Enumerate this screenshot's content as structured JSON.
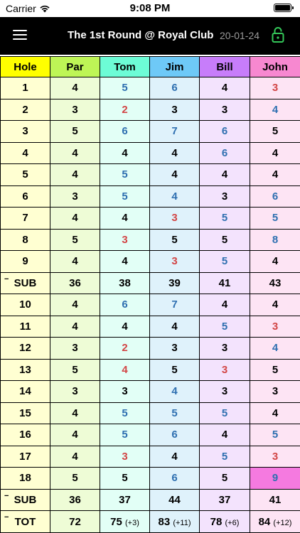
{
  "status_bar": {
    "carrier": "Carrier",
    "time": "9:08 PM"
  },
  "nav": {
    "title": "The 1st Round @ Royal Club",
    "date": "20-01-24"
  },
  "headers": [
    "Hole",
    "Par",
    "Tom",
    "Jim",
    "Bill",
    "John"
  ],
  "header_colors": [
    "#ffff00",
    "#bef556",
    "#6dfcd6",
    "#6ec9f7",
    "#c77dfa",
    "#f788d0"
  ],
  "column_tints": [
    "#ffffd2",
    "#eefcd6",
    "#e2fff6",
    "#dff2fb",
    "#f3e3fd",
    "#fde4f4"
  ],
  "hole_rows": [
    {
      "hole": "1",
      "par": "4",
      "scores": [
        "5",
        "6",
        "4",
        "3"
      ]
    },
    {
      "hole": "2",
      "par": "3",
      "scores": [
        "2",
        "3",
        "3",
        "4"
      ]
    },
    {
      "hole": "3",
      "par": "5",
      "scores": [
        "6",
        "7",
        "6",
        "5"
      ]
    },
    {
      "hole": "4",
      "par": "4",
      "scores": [
        "4",
        "4",
        "6",
        "4"
      ]
    },
    {
      "hole": "5",
      "par": "4",
      "scores": [
        "5",
        "4",
        "4",
        "4"
      ]
    },
    {
      "hole": "6",
      "par": "3",
      "scores": [
        "5",
        "4",
        "3",
        "6"
      ]
    },
    {
      "hole": "7",
      "par": "4",
      "scores": [
        "4",
        "3",
        "5",
        "5"
      ]
    },
    {
      "hole": "8",
      "par": "5",
      "scores": [
        "3",
        "5",
        "5",
        "8"
      ]
    },
    {
      "hole": "9",
      "par": "4",
      "scores": [
        "4",
        "3",
        "5",
        "4"
      ]
    },
    {
      "hole": "SUB",
      "par": "36",
      "scores": [
        "38",
        "39",
        "41",
        "43"
      ],
      "type": "sub"
    },
    {
      "hole": "10",
      "par": "4",
      "scores": [
        "6",
        "7",
        "4",
        "4"
      ]
    },
    {
      "hole": "11",
      "par": "4",
      "scores": [
        "4",
        "4",
        "5",
        "3"
      ]
    },
    {
      "hole": "12",
      "par": "3",
      "scores": [
        "2",
        "3",
        "3",
        "4"
      ]
    },
    {
      "hole": "13",
      "par": "5",
      "scores": [
        "4",
        "5",
        "3",
        "5"
      ]
    },
    {
      "hole": "14",
      "par": "3",
      "scores": [
        "3",
        "4",
        "3",
        "3"
      ]
    },
    {
      "hole": "15",
      "par": "4",
      "scores": [
        "5",
        "5",
        "5",
        "4"
      ]
    },
    {
      "hole": "16",
      "par": "4",
      "scores": [
        "5",
        "6",
        "4",
        "5"
      ]
    },
    {
      "hole": "17",
      "par": "4",
      "scores": [
        "3",
        "4",
        "5",
        "3"
      ]
    },
    {
      "hole": "18",
      "par": "5",
      "scores": [
        "5",
        "6",
        "5",
        "9"
      ]
    },
    {
      "hole": "SUB",
      "par": "36",
      "scores": [
        "37",
        "44",
        "37",
        "41"
      ],
      "type": "sub"
    }
  ],
  "total_row": {
    "label": "TOT",
    "par": "72",
    "scores": [
      "75",
      "83",
      "78",
      "84"
    ],
    "diffs": [
      "(+3)",
      "(+11)",
      "(+6)",
      "(+12)"
    ]
  },
  "highlight_color": "#f57ae0"
}
